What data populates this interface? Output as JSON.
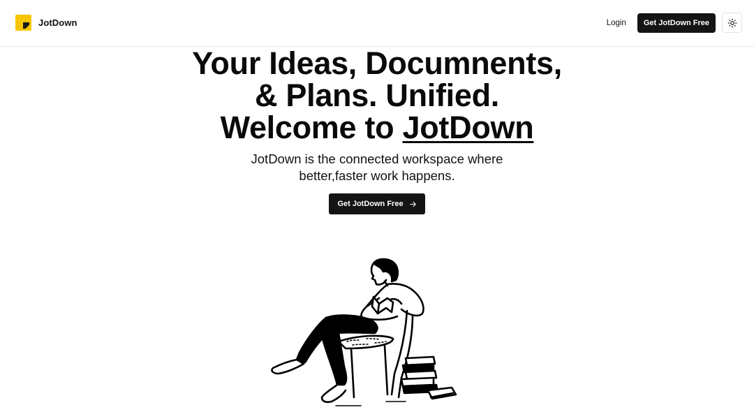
{
  "navbar": {
    "brand_name": "JotDown",
    "login_label": "Login",
    "cta_label": "Get JotDown Free",
    "theme_icon": "sun-icon",
    "logo_colors": {
      "primary": "#f7c600",
      "accent": "#1a1a1a"
    }
  },
  "hero": {
    "headline_line1": "Your Ideas, Documnents,",
    "headline_line2": "& Plans. Unified.",
    "headline_line3_prefix": "Welcome to ",
    "headline_line3_brand": "JotDown",
    "subtitle_line1": "JotDown is the connected workspace where",
    "subtitle_line2": "better,faster work happens.",
    "cta_label": "Get JotDown Free",
    "cta_icon": "arrow-right-icon"
  },
  "illustration": {
    "icon": "person-reading-illustration"
  },
  "colors": {
    "background": "#ffffff",
    "text": "#0b0b0b",
    "button": "#141414",
    "button_text": "#ffffff",
    "brand_yellow": "#f7c600"
  }
}
